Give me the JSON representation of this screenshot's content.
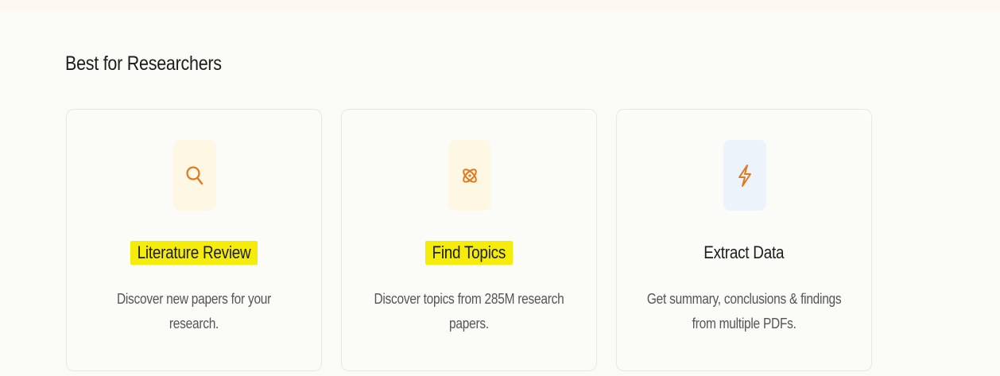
{
  "section": {
    "title": "Best for Researchers"
  },
  "cards": [
    {
      "title": "Literature Review",
      "description": "Discover new papers for your research.",
      "icon": "search-icon",
      "highlighted": true
    },
    {
      "title": "Find Topics",
      "description_lines": [
        "Discover topics from 285M research",
        "papers."
      ],
      "icon": "atom-icon",
      "highlighted": true
    },
    {
      "title": "Extract Data",
      "description_lines": [
        "Get summary, conclusions & findings",
        "from multiple PDFs."
      ],
      "icon": "lightning-icon",
      "highlighted": false
    }
  ],
  "colors": {
    "highlight": "#f5ec0a",
    "icon_accent": "#e07a1f",
    "warm_tile": "#fdf7e4",
    "cool_tile": "#edf3fb"
  }
}
